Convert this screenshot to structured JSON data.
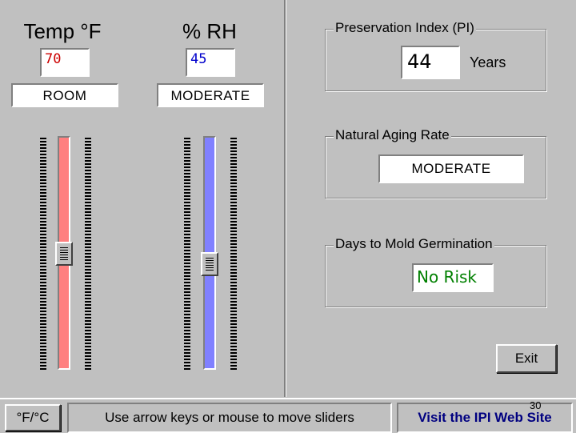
{
  "temp": {
    "header": "Temp °F",
    "value": "70",
    "value_color": "#cc0000",
    "category": "ROOM",
    "slider_color": "#ff8080",
    "slider_level": 0.5
  },
  "rh": {
    "header": "% RH",
    "value": "45",
    "value_color": "#0000cc",
    "category": "MODERATE",
    "slider_color": "#8080ff",
    "slider_level": 0.45
  },
  "pi": {
    "title": "Preservation Index (PI)",
    "value": "44",
    "unit": "Years"
  },
  "aging": {
    "title": "Natural Aging Rate",
    "value": "MODERATE"
  },
  "mold": {
    "title": "Days to Mold Germination",
    "value": "No Risk",
    "value_color": "#008000"
  },
  "buttons": {
    "exit": "Exit",
    "units_toggle": "°F/°C"
  },
  "status": {
    "hint": "Use arrow keys or mouse to move sliders",
    "link": "Visit the IPI Web Site",
    "slide_number": "30"
  }
}
